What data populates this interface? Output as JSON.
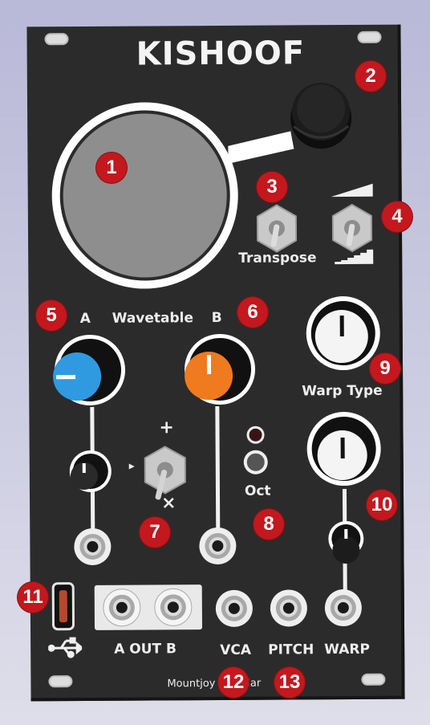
{
  "brand": {
    "title": "KISHOOF",
    "footer": "Mountjoy Modular"
  },
  "controls": {
    "transpose_label": "Transpose",
    "wavetable_a_label": "A",
    "wavetable_title": "Wavetable",
    "wavetable_b_label": "B",
    "warp_type_label": "Warp Type",
    "oct_label": "Oct",
    "switch_plus": "+",
    "switch_times": "×",
    "switch_arrow": "▸"
  },
  "outputs": {
    "a_out_b_label": "A OUT B",
    "vca_label": "VCA",
    "pitch_label": "PITCH",
    "warp_label": "WARP"
  },
  "callouts": [
    "1",
    "2",
    "3",
    "4",
    "5",
    "6",
    "7",
    "8",
    "9",
    "10",
    "11",
    "12",
    "13"
  ],
  "colors": {
    "panel": "#2b2b2b",
    "knob_a": "#2f9ae0",
    "knob_b": "#f07a1e",
    "badge": "#c3181d"
  },
  "icons": {
    "usb": "usb-icon"
  }
}
